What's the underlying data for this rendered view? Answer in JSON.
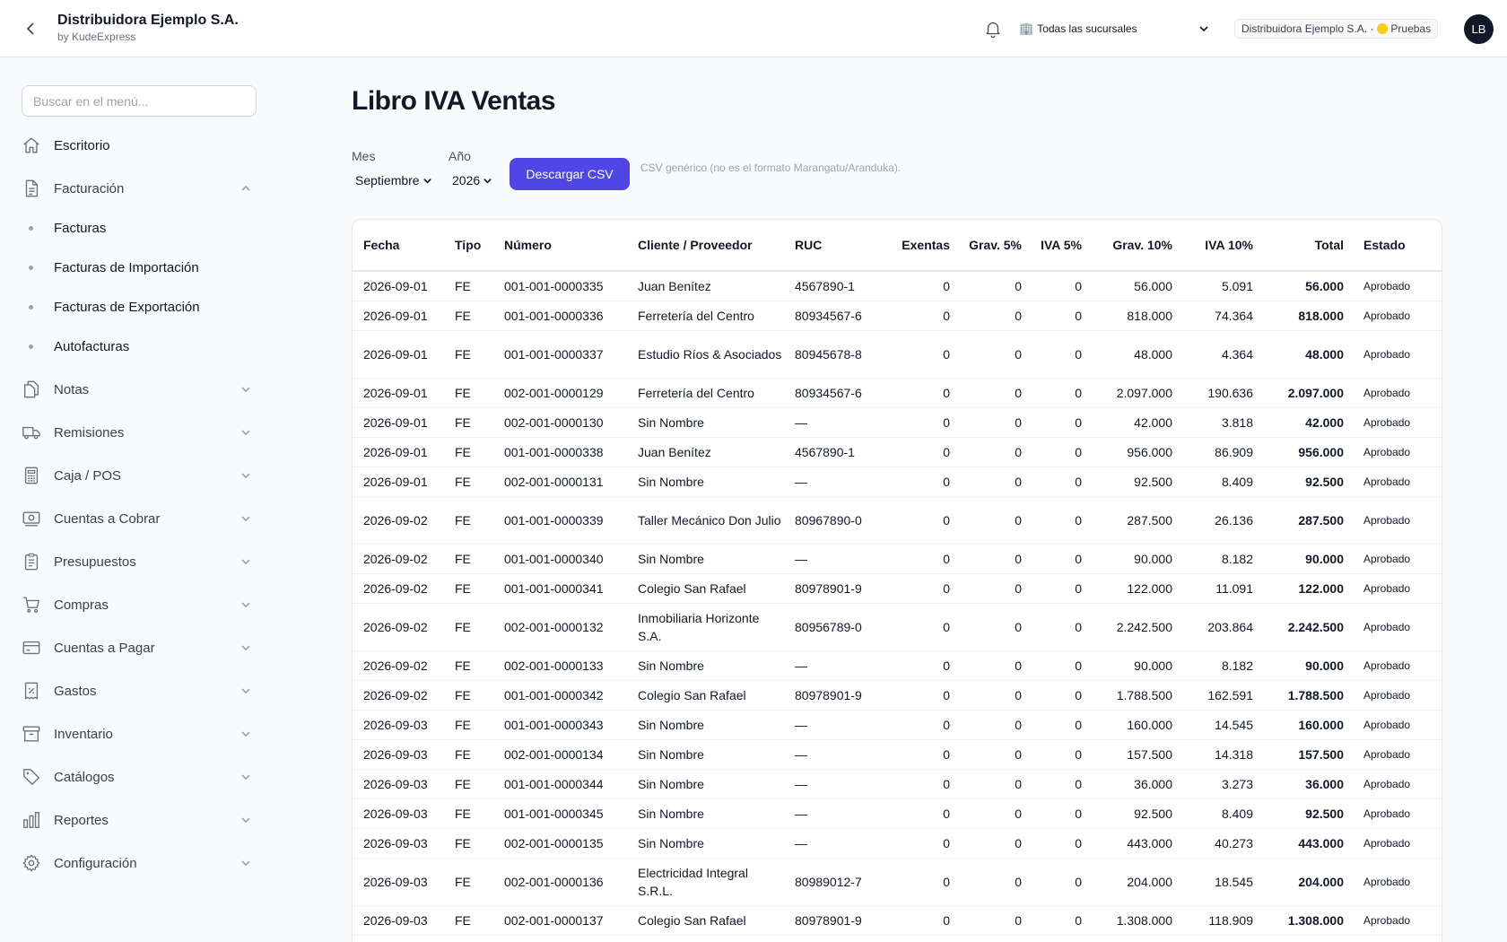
{
  "header": {
    "company_name": "Distribuidora Ejemplo S.A.",
    "company_sub": "by KudeExpress",
    "branch_icon": "🏢",
    "branch_label": "Todas las sucursales",
    "pill_company": "Distribuidora Ejemplo S.A. ·",
    "pill_env": "Pruebas",
    "avatar_initials": "LB"
  },
  "sidebar": {
    "search_placeholder": "Buscar en el menú...",
    "items": [
      {
        "label": "Escritorio"
      },
      {
        "label": "Facturación"
      },
      {
        "label": "Notas"
      },
      {
        "label": "Remisiones"
      },
      {
        "label": "Caja / POS"
      },
      {
        "label": "Cuentas a Cobrar"
      },
      {
        "label": "Presupuestos"
      },
      {
        "label": "Compras"
      },
      {
        "label": "Cuentas a Pagar"
      },
      {
        "label": "Gastos"
      },
      {
        "label": "Inventario"
      },
      {
        "label": "Catálogos"
      },
      {
        "label": "Reportes"
      },
      {
        "label": "Configuración"
      }
    ],
    "facturacion_sub": [
      {
        "label": "Facturas"
      },
      {
        "label": "Facturas de Importación"
      },
      {
        "label": "Facturas de Exportación"
      },
      {
        "label": "Autofacturas"
      }
    ]
  },
  "main": {
    "title": "Libro IVA Ventas",
    "mes_label": "Mes",
    "mes_value": "Septiembre",
    "anio_label": "Año",
    "anio_value": "2026",
    "download_label": "Descargar CSV",
    "hint": "CSV genérico (no es el formato Marangatu/Aranduka)."
  },
  "table": {
    "columns": [
      "Fecha",
      "Tipo",
      "Número",
      "Cliente / Proveedor",
      "RUC",
      "Exentas",
      "Grav. 5%",
      "IVA 5%",
      "Grav. 10%",
      "IVA 10%",
      "Total",
      "Estado"
    ],
    "rows": [
      [
        "2026-09-01",
        "FE",
        "001-001-0000335",
        "Juan Benítez",
        "4567890-1",
        "0",
        "0",
        "0",
        "56.000",
        "5.091",
        "56.000",
        "Aprobado"
      ],
      [
        "2026-09-01",
        "FE",
        "001-001-0000336",
        "Ferretería del Centro",
        "80934567-6",
        "0",
        "0",
        "0",
        "818.000",
        "74.364",
        "818.000",
        "Aprobado"
      ],
      [
        "2026-09-01",
        "FE",
        "001-001-0000337",
        "Estudio Ríos & Asociados",
        "80945678-8",
        "0",
        "0",
        "0",
        "48.000",
        "4.364",
        "48.000",
        "Aprobado"
      ],
      [
        "2026-09-01",
        "FE",
        "002-001-0000129",
        "Ferretería del Centro",
        "80934567-6",
        "0",
        "0",
        "0",
        "2.097.000",
        "190.636",
        "2.097.000",
        "Aprobado"
      ],
      [
        "2026-09-01",
        "FE",
        "002-001-0000130",
        "Sin Nombre",
        "—",
        "0",
        "0",
        "0",
        "42.000",
        "3.818",
        "42.000",
        "Aprobado"
      ],
      [
        "2026-09-01",
        "FE",
        "001-001-0000338",
        "Juan Benítez",
        "4567890-1",
        "0",
        "0",
        "0",
        "956.000",
        "86.909",
        "956.000",
        "Aprobado"
      ],
      [
        "2026-09-01",
        "FE",
        "002-001-0000131",
        "Sin Nombre",
        "—",
        "0",
        "0",
        "0",
        "92.500",
        "8.409",
        "92.500",
        "Aprobado"
      ],
      [
        "2026-09-02",
        "FE",
        "001-001-0000339",
        "Taller Mecánico Don Julio",
        "80967890-0",
        "0",
        "0",
        "0",
        "287.500",
        "26.136",
        "287.500",
        "Aprobado"
      ],
      [
        "2026-09-02",
        "FE",
        "001-001-0000340",
        "Sin Nombre",
        "—",
        "0",
        "0",
        "0",
        "90.000",
        "8.182",
        "90.000",
        "Aprobado"
      ],
      [
        "2026-09-02",
        "FE",
        "001-001-0000341",
        "Colegio San Rafael",
        "80978901-9",
        "0",
        "0",
        "0",
        "122.000",
        "11.091",
        "122.000",
        "Aprobado"
      ],
      [
        "2026-09-02",
        "FE",
        "002-001-0000132",
        "Inmobiliaria Horizonte S.A.",
        "80956789-0",
        "0",
        "0",
        "0",
        "2.242.500",
        "203.864",
        "2.242.500",
        "Aprobado"
      ],
      [
        "2026-09-02",
        "FE",
        "002-001-0000133",
        "Sin Nombre",
        "—",
        "0",
        "0",
        "0",
        "90.000",
        "8.182",
        "90.000",
        "Aprobado"
      ],
      [
        "2026-09-02",
        "FE",
        "001-001-0000342",
        "Colegio San Rafael",
        "80978901-9",
        "0",
        "0",
        "0",
        "1.788.500",
        "162.591",
        "1.788.500",
        "Aprobado"
      ],
      [
        "2026-09-03",
        "FE",
        "001-001-0000343",
        "Sin Nombre",
        "—",
        "0",
        "0",
        "0",
        "160.000",
        "14.545",
        "160.000",
        "Aprobado"
      ],
      [
        "2026-09-03",
        "FE",
        "002-001-0000134",
        "Sin Nombre",
        "—",
        "0",
        "0",
        "0",
        "157.500",
        "14.318",
        "157.500",
        "Aprobado"
      ],
      [
        "2026-09-03",
        "FE",
        "001-001-0000344",
        "Sin Nombre",
        "—",
        "0",
        "0",
        "0",
        "36.000",
        "3.273",
        "36.000",
        "Aprobado"
      ],
      [
        "2026-09-03",
        "FE",
        "001-001-0000345",
        "Sin Nombre",
        "—",
        "0",
        "0",
        "0",
        "92.500",
        "8.409",
        "92.500",
        "Aprobado"
      ],
      [
        "2026-09-03",
        "FE",
        "002-001-0000135",
        "Sin Nombre",
        "—",
        "0",
        "0",
        "0",
        "443.000",
        "40.273",
        "443.000",
        "Aprobado"
      ],
      [
        "2026-09-03",
        "FE",
        "002-001-0000136",
        "Electricidad Integral S.R.L.",
        "80989012-7",
        "0",
        "0",
        "0",
        "204.000",
        "18.545",
        "204.000",
        "Aprobado"
      ],
      [
        "2026-09-03",
        "FE",
        "002-001-0000137",
        "Colegio San Rafael",
        "80978901-9",
        "0",
        "0",
        "0",
        "1.308.000",
        "118.909",
        "1.308.000",
        "Aprobado"
      ]
    ]
  },
  "colors": {
    "accent": "#4f46e5",
    "env_dot": "#facc15",
    "avatar_bg": "#111827"
  },
  "icons": [
    "back-arrow-icon",
    "bell-icon",
    "building-icon",
    "chevron-down-icon",
    "chevron-up-icon",
    "home-icon",
    "document-icon",
    "copy-icon",
    "truck-icon",
    "calculator-icon",
    "cash-icon",
    "clipboard-icon",
    "cart-icon",
    "credit-card-icon",
    "receipt-icon",
    "archive-icon",
    "tag-icon",
    "bar-chart-icon",
    "gear-icon"
  ]
}
